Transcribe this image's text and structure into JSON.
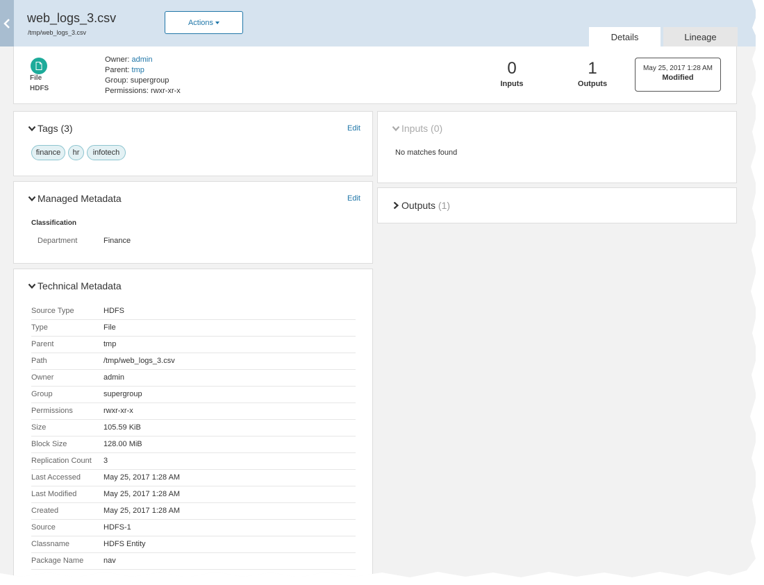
{
  "header": {
    "title": "web_logs_3.csv",
    "path": "/tmp/web_logs_3.csv",
    "actions_label": "Actions",
    "tabs": [
      {
        "label": "Details"
      },
      {
        "label": "Lineage"
      }
    ]
  },
  "summary": {
    "type": "File",
    "source": "HDFS",
    "owner_label": "Owner:",
    "owner": "admin",
    "parent_label": "Parent:",
    "parent": "tmp",
    "group_label": "Group:",
    "group": "supergroup",
    "permissions_label": "Permissions:",
    "permissions": "rwxr-xr-x",
    "inputs_count": "0",
    "inputs_label": "Inputs",
    "outputs_count": "1",
    "outputs_label": "Outputs",
    "modified_date": "May 25, 2017 1:28 AM",
    "modified_label": "Modified"
  },
  "tags_panel": {
    "title": "Tags (3)",
    "edit_label": "Edit",
    "tags": [
      "finance",
      "hr",
      "infotech"
    ]
  },
  "managed_metadata": {
    "title": "Managed Metadata",
    "edit_label": "Edit",
    "section": "Classification",
    "key": "Department",
    "value": "Finance"
  },
  "technical_metadata": {
    "title": "Technical Metadata",
    "rows": [
      {
        "key": "Source Type",
        "value": "HDFS"
      },
      {
        "key": "Type",
        "value": "File"
      },
      {
        "key": "Parent",
        "value": "tmp"
      },
      {
        "key": "Path",
        "value": "/tmp/web_logs_3.csv"
      },
      {
        "key": "Owner",
        "value": "admin"
      },
      {
        "key": "Group",
        "value": "supergroup"
      },
      {
        "key": "Permissions",
        "value": "rwxr-xr-x"
      },
      {
        "key": "Size",
        "value": "105.59 KiB"
      },
      {
        "key": "Block Size",
        "value": "128.00 MiB"
      },
      {
        "key": "Replication Count",
        "value": "3"
      },
      {
        "key": "Last Accessed",
        "value": "May 25, 2017 1:28 AM"
      },
      {
        "key": "Last Modified",
        "value": "May 25, 2017 1:28 AM"
      },
      {
        "key": "Created",
        "value": "May 25, 2017 1:28 AM"
      },
      {
        "key": "Source",
        "value": "HDFS-1"
      },
      {
        "key": "Classname",
        "value": "HDFS Entity"
      },
      {
        "key": "Package Name",
        "value": "nav"
      }
    ]
  },
  "inputs_panel": {
    "title": "Inputs",
    "count": "(0)",
    "empty_text": "No matches found"
  },
  "outputs_panel": {
    "title": "Outputs",
    "count": "(1)"
  },
  "colors": {
    "header_bg": "#d6e3ef",
    "link": "#1f76a8",
    "file_icon": "#1dab9a",
    "tag_bg": "#e3f1f4"
  }
}
